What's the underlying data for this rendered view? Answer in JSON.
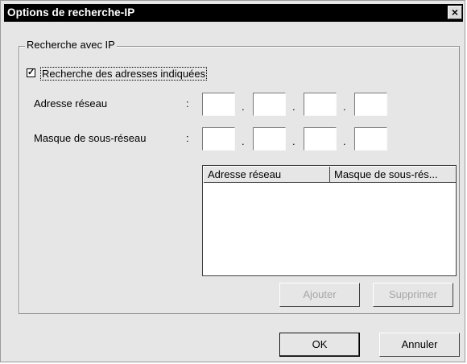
{
  "window": {
    "title": "Options de recherche-IP",
    "close_glyph": "×"
  },
  "group": {
    "label": "Recherche avec IP",
    "checkbox_label": "Recherche des adresses indiquées",
    "checkbox_checked": true,
    "checkbox_mark": "✓"
  },
  "fields": {
    "network_address_label": "Adresse réseau",
    "subnet_mask_label": "Masque de sous-réseau",
    "colon": ":",
    "octet_separator": ".",
    "network_address_octets": [
      "",
      "",
      "",
      ""
    ],
    "subnet_mask_octets": [
      "",
      "",
      "",
      ""
    ]
  },
  "list": {
    "columns": [
      "Adresse réseau",
      "Masque de sous-rés..."
    ],
    "rows": []
  },
  "buttons": {
    "add": "Ajouter",
    "remove": "Supprimer",
    "ok": "OK",
    "cancel": "Annuler"
  },
  "icons": {
    "close": "close-icon",
    "checkmark": "checkmark-icon"
  }
}
